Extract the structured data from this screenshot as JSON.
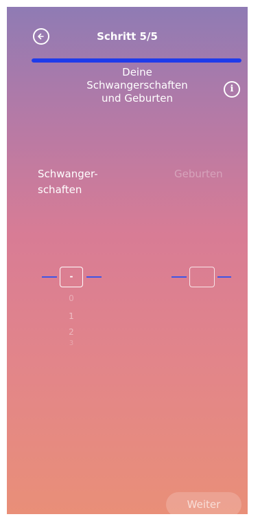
{
  "header": {
    "step_label": "Schritt 5/5",
    "progress_percent": 100
  },
  "heading": {
    "line1": "Deine",
    "line2": "Schwangerschaften",
    "line3": "und Geburten"
  },
  "info_label": "i",
  "pregnancies": {
    "label_line1": "Schwanger-",
    "label_line2": "schaften",
    "selected_value": "-",
    "options": [
      "0",
      "1",
      "2",
      "3"
    ]
  },
  "births": {
    "label": "Geburten",
    "selected_value": ""
  },
  "footer": {
    "next_label": "Weiter"
  },
  "colors": {
    "accent": "#1f3bea",
    "picker_line": "#3e55e6"
  }
}
